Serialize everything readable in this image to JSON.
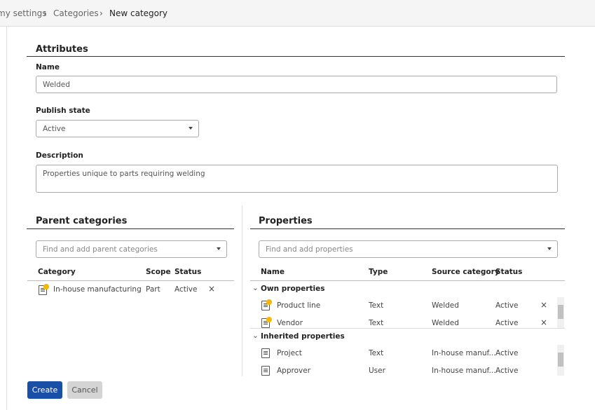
{
  "breadcrumb": [
    "my settings",
    "Categories",
    "New category"
  ],
  "attributes": {
    "heading": "Attributes",
    "name_label": "Name",
    "name_value": "Welded",
    "publish_label": "Publish state",
    "publish_value": "Active",
    "description_label": "Description",
    "description_value": "Properties unique to parts requiring welding"
  },
  "parent": {
    "heading": "Parent categories",
    "search_placeholder": "Find and add parent categories",
    "columns": [
      "Category",
      "Scope",
      "Status"
    ],
    "rows": [
      {
        "name": "In-house manufacturing",
        "scope": "Part",
        "status": "Active"
      }
    ]
  },
  "properties": {
    "heading": "Properties",
    "search_placeholder": "Find and add properties",
    "columns": [
      "Name",
      "Type",
      "Source category",
      "Status"
    ],
    "own_label": "Own properties",
    "own": [
      {
        "name": "Product line",
        "type": "Text",
        "source": "Welded",
        "status": "Active"
      },
      {
        "name": "Vendor",
        "type": "Text",
        "source": "Welded",
        "status": "Active"
      }
    ],
    "inherited_label": "Inherited properties",
    "inherited": [
      {
        "name": "Project",
        "type": "Text",
        "source": "In-house manuf...",
        "status": "Active"
      },
      {
        "name": "Approver",
        "type": "User",
        "source": "In-house manuf...",
        "status": "Active"
      }
    ]
  },
  "buttons": {
    "create": "Create",
    "cancel": "Cancel"
  },
  "colors": {
    "primary": "#1a4fa8",
    "badge": "#f5b800"
  },
  "icons": {
    "remove": "×",
    "chevron": "⌄"
  }
}
